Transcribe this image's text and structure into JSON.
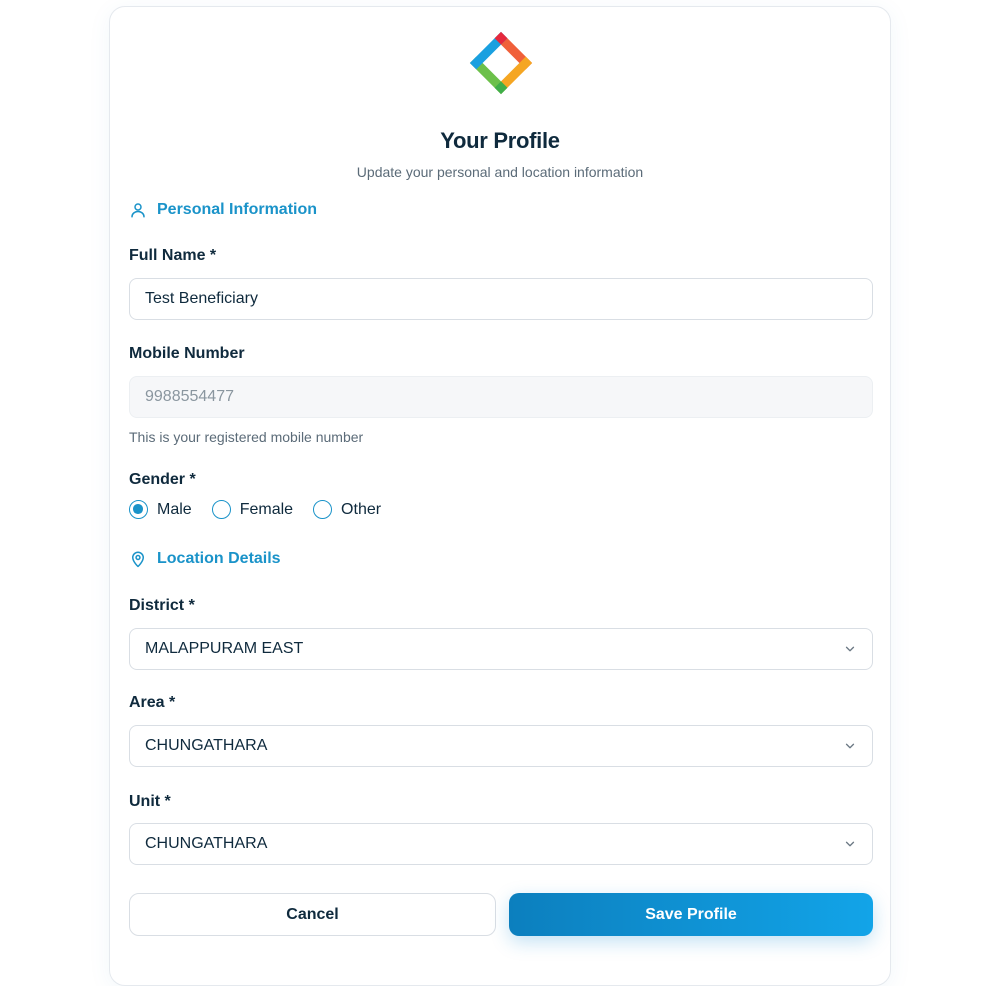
{
  "header": {
    "title": "Your Profile",
    "subtitle": "Update your personal and location information"
  },
  "sections": {
    "personal": "Personal Information",
    "location": "Location Details"
  },
  "fields": {
    "full_name": {
      "label": "Full Name *",
      "value": "Test Beneficiary"
    },
    "mobile": {
      "label": "Mobile Number",
      "value": "9988554477",
      "hint": "This is your registered mobile number"
    },
    "gender": {
      "label": "Gender *",
      "options": [
        "Male",
        "Female",
        "Other"
      ],
      "selected": "Male"
    },
    "district": {
      "label": "District *",
      "value": "MALAPPURAM EAST"
    },
    "area": {
      "label": "Area *",
      "value": "CHUNGATHARA"
    },
    "unit": {
      "label": "Unit *",
      "value": "CHUNGATHARA"
    }
  },
  "actions": {
    "cancel": "Cancel",
    "save": "Save Profile"
  },
  "colors": {
    "accent": "#1a93c9",
    "primary_button_start": "#0c7fbe",
    "primary_button_end": "#12a4e8",
    "text": "#0f2a3d"
  },
  "icons": {
    "logo": "app-logo",
    "personal": "user-icon",
    "location": "map-pin-icon",
    "select": "chevron-down-icon"
  }
}
